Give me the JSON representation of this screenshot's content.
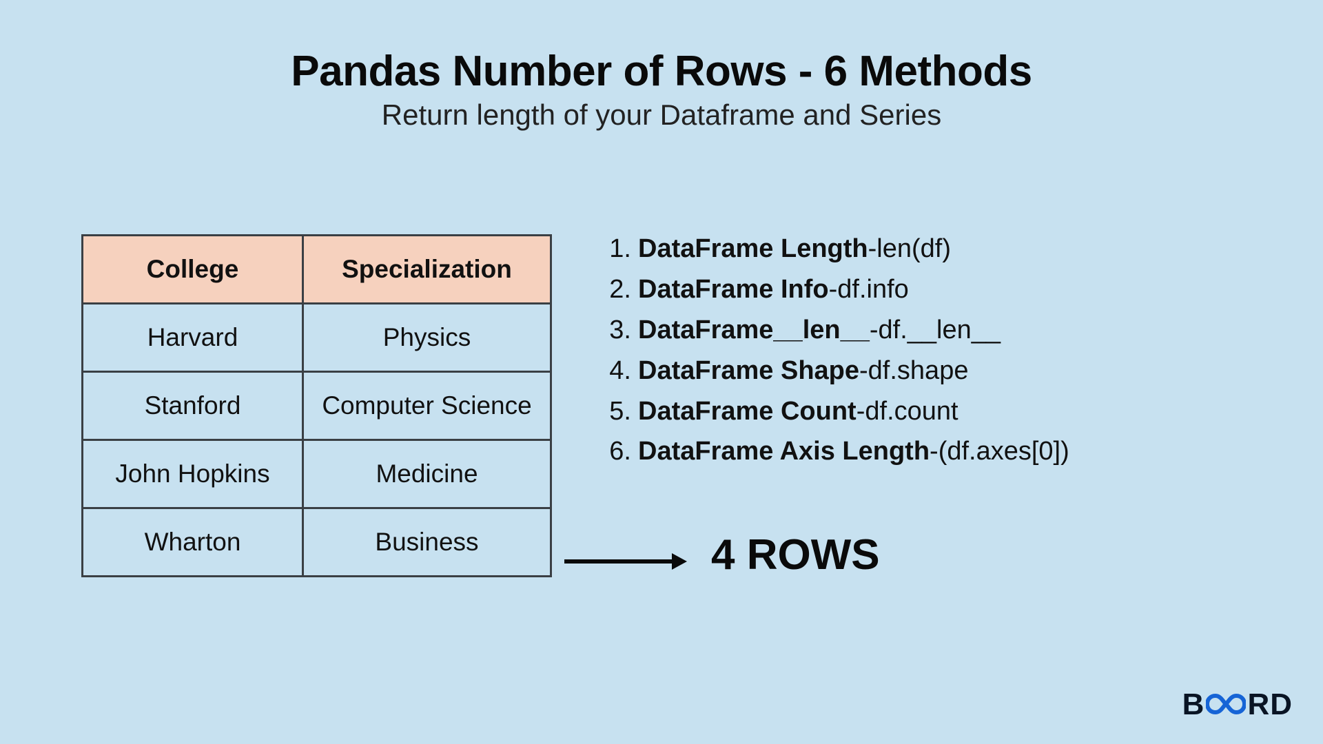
{
  "heading": {
    "title": "Pandas Number of Rows - 6 Methods",
    "subtitle": "Return length of your Dataframe and Series"
  },
  "table": {
    "headers": [
      "College",
      "Specialization"
    ],
    "rows": [
      [
        "Harvard",
        "Physics"
      ],
      [
        "Stanford",
        "Computer Science"
      ],
      [
        "John Hopkins",
        "Medicine"
      ],
      [
        "Wharton",
        "Business"
      ]
    ]
  },
  "methods": [
    {
      "num": "1.",
      "name": "DataFrame Length",
      "sep": " - ",
      "code": "len(df)"
    },
    {
      "num": "2.",
      "name": "DataFrame Info",
      "sep": " - ",
      "code": "df.info"
    },
    {
      "num": "3.",
      "name": "DataFrame__len__",
      "sep": " - ",
      "code": "df.__len__"
    },
    {
      "num": "4.",
      "name": "DataFrame Shape",
      "sep": " - ",
      "code": "df.shape"
    },
    {
      "num": "5.",
      "name": "DataFrame Count",
      "sep": " - ",
      "code": "df.count"
    },
    {
      "num": "6.",
      "name": "DataFrame Axis Length",
      "sep": " - ",
      "code": "(df.axes[0])"
    }
  ],
  "result_label": "4 ROWS",
  "brand": {
    "b1": "B",
    "b2": "RD"
  }
}
